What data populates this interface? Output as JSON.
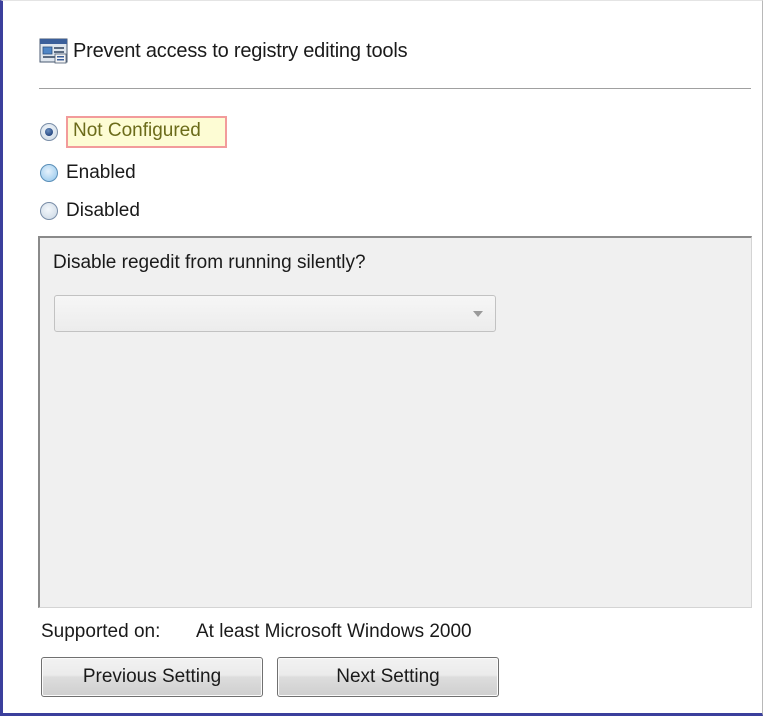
{
  "header": {
    "icon": "policy-setting-icon",
    "title": "Prevent access to registry editing tools"
  },
  "state": {
    "options": [
      {
        "label": "Not Configured",
        "checked": true
      },
      {
        "label": "Enabled",
        "checked": false
      },
      {
        "label": "Disabled",
        "checked": false
      }
    ]
  },
  "options_panel": {
    "question": "Disable regedit from running silently?",
    "dropdown_value": ""
  },
  "supported": {
    "label": "Supported on:",
    "value": "At least Microsoft Windows 2000"
  },
  "buttons": {
    "previous": "Previous Setting",
    "next": "Next Setting"
  },
  "colors": {
    "frame_border": "#3b3f9c",
    "highlight_fill": "#fdfcd4",
    "highlight_border": "#f29b9b"
  }
}
